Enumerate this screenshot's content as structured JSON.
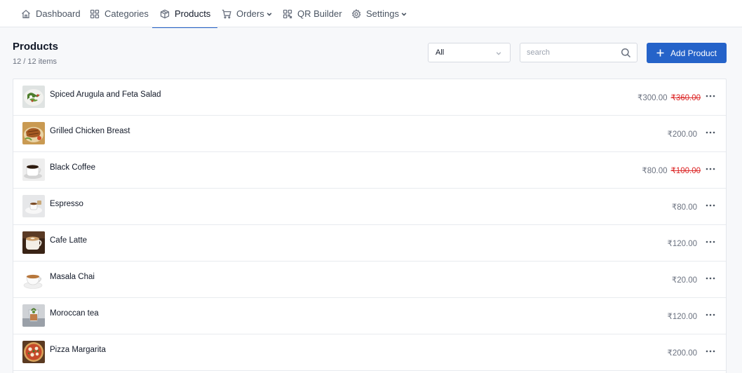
{
  "nav": {
    "items": [
      {
        "label": "Dashboard",
        "icon": "home-icon"
      },
      {
        "label": "Categories",
        "icon": "grid-icon"
      },
      {
        "label": "Products",
        "icon": "box-icon"
      },
      {
        "label": "Orders",
        "icon": "cart-icon"
      },
      {
        "label": "QR Builder",
        "icon": "qr-icon"
      },
      {
        "label": "Settings",
        "icon": "gear-icon"
      }
    ],
    "active": "Products"
  },
  "header": {
    "title": "Products",
    "count": "12 / 12 items"
  },
  "filter": {
    "selected": "All"
  },
  "search": {
    "placeholder": "search",
    "value": ""
  },
  "add_button": {
    "label": "Add Product"
  },
  "colors": {
    "accent": "#2563c9",
    "strike": "#dc2626"
  },
  "products": [
    {
      "name": "Spiced Arugula and Feta Salad",
      "price": "₹300.00",
      "original_price": "₹360.00",
      "image": "salad-photo"
    },
    {
      "name": "Grilled Chicken Breast",
      "price": "₹200.00",
      "original_price": "",
      "image": "chicken-photo"
    },
    {
      "name": "Black Coffee",
      "price": "₹80.00",
      "original_price": "₹100.00",
      "image": "coffee-photo"
    },
    {
      "name": "Espresso",
      "price": "₹80.00",
      "original_price": "",
      "image": "espresso-photo"
    },
    {
      "name": "Cafe Latte",
      "price": "₹120.00",
      "original_price": "",
      "image": "latte-photo"
    },
    {
      "name": "Masala Chai",
      "price": "₹20.00",
      "original_price": "",
      "image": "chai-photo"
    },
    {
      "name": "Moroccan tea",
      "price": "₹120.00",
      "original_price": "",
      "image": "tea-photo"
    },
    {
      "name": "Pizza Margarita",
      "price": "₹200.00",
      "original_price": "",
      "image": "pizza-photo"
    }
  ]
}
